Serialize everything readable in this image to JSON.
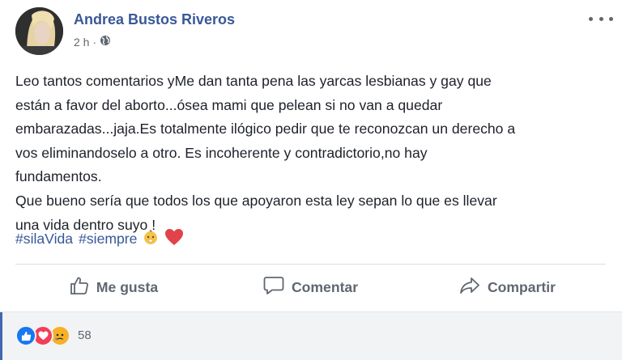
{
  "post": {
    "author": "Andrea Bustos Riveros",
    "time": "2 h",
    "separator": "·",
    "body_lines": [
      "Leo tantos comentarios yMe dan tanta pena las yarcas lesbianas y gay que",
      "están a favor del aborto...ósea mami que pelean si no van a quedar",
      "embarazadas...jaja.Es totalmente ilógico pedir que te reconozcan un derecho a",
      "vos eliminandoselo a otro. Es incoherente y contradictorio,no hay",
      "fundamentos.",
      "Que bueno sería que todos los que apoyaron esta ley sepan lo que es llevar",
      "una vida dentro suyo !"
    ],
    "hashtags": [
      "#silaVida",
      "#siempre"
    ],
    "emojis": [
      "baby-emoji",
      "red-heart-emoji"
    ]
  },
  "actions": {
    "like": "Me gusta",
    "comment": "Comentar",
    "share": "Compartir"
  },
  "reactions": {
    "icons": [
      "like-reaction-icon",
      "love-reaction-icon",
      "sad-reaction-icon"
    ],
    "count": "58"
  },
  "colors": {
    "link": "#385898",
    "text": "#1d2129",
    "muted": "#606770",
    "like": "#1877f2",
    "love": "#f33e58",
    "sad": "#f7b125"
  }
}
